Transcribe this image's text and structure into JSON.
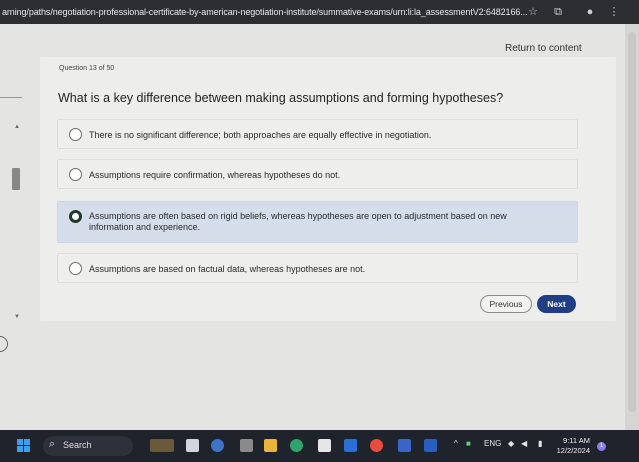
{
  "browser": {
    "url": "arning/paths/negotiation-professional-certificate-by-american-negotiation-institute/summative-exams/urn:li:la_assessmentV2:6482166..."
  },
  "page": {
    "return_link": "Return to content"
  },
  "quiz": {
    "question_number": "Question 13 of 50",
    "question": "What is a key difference between making assumptions and forming hypotheses?",
    "options": [
      {
        "text": "There is no significant difference; both approaches are equally effective in negotiation.",
        "selected": false
      },
      {
        "text": "Assumptions require confirmation, whereas hypotheses do not.",
        "selected": false
      },
      {
        "text": "Assumptions are often based on rigid beliefs, whereas hypotheses are open to adjustment based on new information and experience.",
        "selected": true
      },
      {
        "text": "Assumptions are based on factual data, whereas hypotheses are not.",
        "selected": false
      }
    ],
    "previous_label": "Previous",
    "next_label": "Next"
  },
  "taskbar": {
    "search_label": "Search",
    "language": "ENG",
    "time": "9:11 AM",
    "date": "12/2/2024",
    "notification_count": "1"
  },
  "colors": {
    "next_button": "#1f3e86",
    "selected_option": "#d4dde9",
    "taskbar": "#1f232b"
  }
}
